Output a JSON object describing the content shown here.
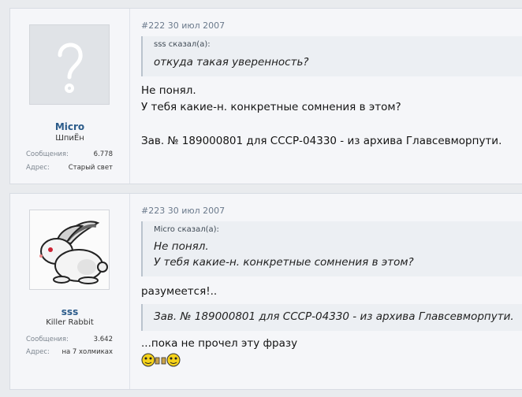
{
  "posts": [
    {
      "author": {
        "name": "Micro",
        "title": "ШпиЁн",
        "stats": [
          {
            "label": "Сообщения:",
            "value": "6.778"
          },
          {
            "label": "Адрес:",
            "value": "Старый свет"
          }
        ]
      },
      "meta": "#222 30 июл 2007",
      "quote": {
        "header": "sss сказал(а):",
        "lines": [
          "откуда такая уверенность?"
        ]
      },
      "body": [
        "Не понял.",
        "У тебя какие-н. конкретные сомнения в этом?",
        "",
        "Зав. № 189000801 для СССР-04330 - из архива Главсевморпути."
      ]
    },
    {
      "author": {
        "name": "sss",
        "title": "Killer Rabbit",
        "stats": [
          {
            "label": "Сообщения:",
            "value": "3.642"
          },
          {
            "label": "Адрес:",
            "value": "на 7 холмиках"
          }
        ]
      },
      "meta": "#223 30 июл 2007",
      "quote": {
        "header": "Micro сказал(а):",
        "lines": [
          "Не понял.",
          "У тебя какие-н. конкретные сомнения в этом?"
        ]
      },
      "reply": "разумеется!..",
      "quote2": {
        "lines": [
          "Зав. № 189000801 для СССР-04330 - из архива Главсевморпути."
        ]
      },
      "body": [
        "...пока не прочел эту фразу"
      ],
      "smileys": [
        "drinking-smiley-icon",
        "drinking-smiley-icon"
      ]
    }
  ],
  "colors": {
    "username": "#2b5b8a",
    "meta": "#6b7a8c",
    "quote_bg": "#eceff3",
    "quote_border": "#bac3cd"
  }
}
